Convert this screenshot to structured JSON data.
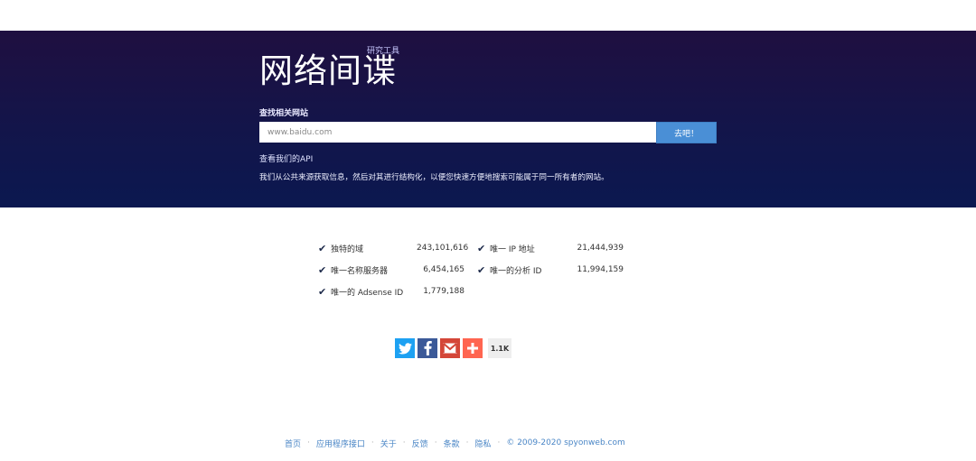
{
  "hero": {
    "logo": "网络间谍",
    "logo_sup": "研究工具",
    "search_label": "查找相关网站",
    "search_value": "",
    "search_placeholder": "www.baidu.com",
    "go_label": "去吧！",
    "api_link": "查看我们的API",
    "description": "我们从公共来源获取信息，然后对其进行结构化，以便您快速方便地搜索可能属于同一所有者的网站。"
  },
  "stats": [
    {
      "label": "独特的域",
      "value": "243,101,616"
    },
    {
      "label": "唯一 IP 地址",
      "value": "21,444,939"
    },
    {
      "label": "唯一名称服务器",
      "value": "6,454,165"
    },
    {
      "label": "唯一的分析 ID",
      "value": "11,994,159"
    },
    {
      "label": "唯一的 Adsense ID",
      "value": "1,779,188"
    }
  ],
  "social": {
    "icons": [
      "twitter-icon",
      "facebook-icon",
      "gmail-icon",
      "plus-icon"
    ],
    "colors": {
      "twitter": "#1da1f2",
      "facebook": "#3b5998",
      "gmail": "#d44638",
      "more": "#ff6550"
    },
    "count": "1.1K"
  },
  "footer": {
    "links": [
      "首页",
      "应用程序接口",
      "关于",
      "反馈",
      "条款",
      "隐私"
    ],
    "copyright": "© 2009-2020 spyonweb.com"
  },
  "colors": {
    "hero_top": "#1f0f40",
    "hero_bottom": "#0b1850",
    "button": "#4a8fd6",
    "link": "#4a86c6"
  }
}
